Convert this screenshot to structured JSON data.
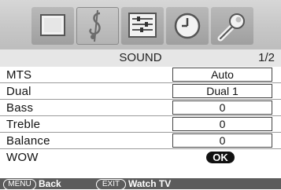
{
  "menu": {
    "title": "SOUND",
    "page": "1/2"
  },
  "icons": [
    {
      "name": "picture-icon"
    },
    {
      "name": "sound-icon"
    },
    {
      "name": "setup-icon"
    },
    {
      "name": "timer-icon"
    },
    {
      "name": "settings-icon"
    }
  ],
  "rows": [
    {
      "label": "MTS",
      "value": "Auto"
    },
    {
      "label": "Dual",
      "value": "Dual 1"
    },
    {
      "label": "Bass",
      "value": "0"
    },
    {
      "label": "Treble",
      "value": "0"
    },
    {
      "label": "Balance",
      "value": "0"
    },
    {
      "label": "WOW",
      "value": "OK"
    }
  ],
  "footer": {
    "menu_key": "MENU",
    "menu_action": "Back",
    "exit_key": "EXIT",
    "exit_action": "Watch TV"
  }
}
